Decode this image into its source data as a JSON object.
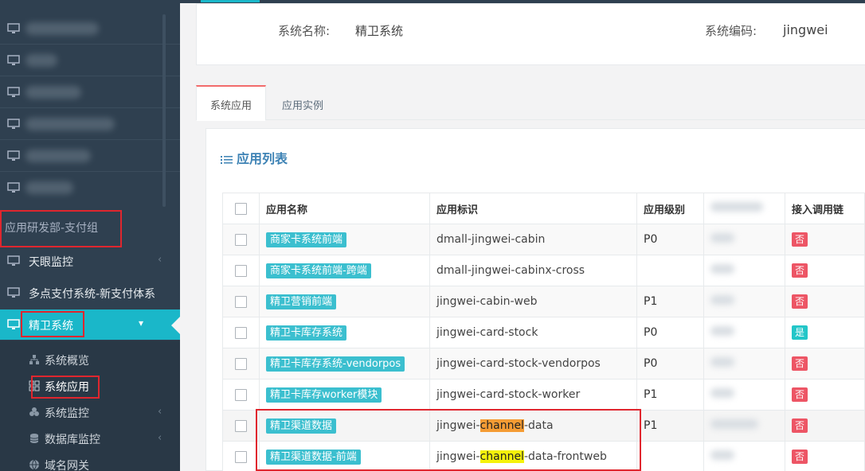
{
  "sidebar": {
    "group_label": "应用研发部-支付组",
    "items": [
      {
        "label": "天眼监控"
      },
      {
        "label": "多点支付系统-新支付体系"
      },
      {
        "label": "精卫系统"
      }
    ],
    "sub_items": [
      {
        "label": "系统概览",
        "icon": "sitemap-icon"
      },
      {
        "label": "系统应用",
        "icon": "grid-icon"
      },
      {
        "label": "系统监控",
        "icon": "cubes-icon"
      },
      {
        "label": "数据库监控",
        "icon": "database-icon"
      },
      {
        "label": "域名网关",
        "icon": "globe-icon"
      }
    ]
  },
  "system_info": {
    "name_label": "系统名称:",
    "name_value": "精卫系统",
    "code_label": "系统编码:",
    "code_value": "jingwei"
  },
  "tabs": [
    {
      "label": "系统应用",
      "active": true
    },
    {
      "label": "应用实例",
      "active": false
    }
  ],
  "panel": {
    "title": "应用列表"
  },
  "table": {
    "headers": {
      "name": "应用名称",
      "identifier": "应用标识",
      "level": "应用级别",
      "chain": "接入调用链"
    },
    "rows": [
      {
        "name": "商家卡系统前端",
        "id": "dmall-jingwei-cabin",
        "level": "P0",
        "chain": "否"
      },
      {
        "name": "商家卡系统前端-跨端",
        "id": "dmall-jingwei-cabinx-cross",
        "level": "",
        "chain": "否"
      },
      {
        "name": "精卫营销前端",
        "id": "jingwei-cabin-web",
        "level": "P1",
        "chain": "否"
      },
      {
        "name": "精卫卡库存系统",
        "id": "jingwei-card-stock",
        "level": "P0",
        "chain": "是"
      },
      {
        "name": "精卫卡库存系统-vendorpos",
        "id": "jingwei-card-stock-vendorpos",
        "level": "P0",
        "chain": "否"
      },
      {
        "name": "精卫卡库存worker模块",
        "id": "jingwei-card-stock-worker",
        "level": "P1",
        "chain": "否"
      },
      {
        "name": "精卫渠道数据",
        "id_prefix": "jingwei-",
        "id_match": "channel",
        "id_suffix": "-data",
        "level": "P1",
        "chain": "否"
      },
      {
        "name": "精卫渠道数据-前端",
        "id_prefix": "jingwei-",
        "id_match": "channel",
        "id_suffix": "-data-frontweb",
        "level": "",
        "chain": "否"
      }
    ]
  },
  "colors": {
    "sidebar_bg": "#2f4050",
    "active_nav": "#1ab7c9",
    "tag": "#3bbfcf",
    "badge_no": "#ed5565",
    "badge_yes": "#23c6c8",
    "annotation_red": "#e0262e"
  }
}
